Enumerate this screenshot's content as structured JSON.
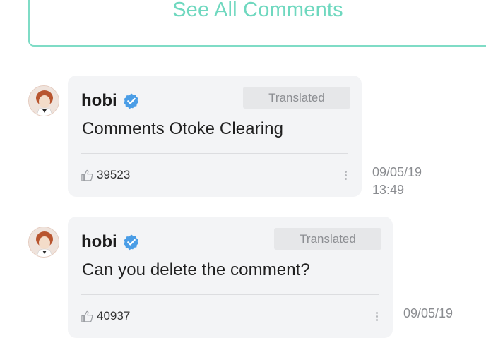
{
  "see_all": {
    "label": "See All Comments"
  },
  "comments": [
    {
      "author": "hobi",
      "translated_label": "Translated",
      "text": "Comments Otoke Clearing",
      "likes": "39523",
      "date": "09/05/19",
      "time": "13:49"
    },
    {
      "author": "hobi",
      "translated_label": "Translated",
      "text": "Can you delete the comment?",
      "likes": "40937",
      "date": "09/05/19"
    }
  ],
  "colors": {
    "accent": "#6fd8bf",
    "bubble": "#f3f4f6",
    "verified": "#4a9de6"
  },
  "icons": [
    "verified-badge-icon",
    "thumbs-up-icon",
    "more-options-icon"
  ]
}
